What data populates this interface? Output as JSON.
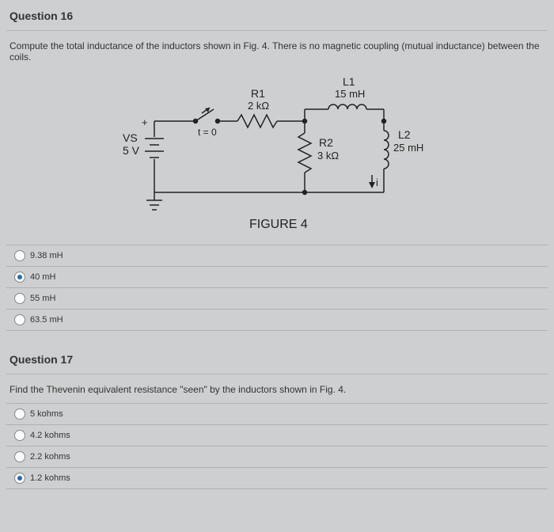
{
  "q16": {
    "header": "Question 16",
    "prompt": "Compute the total inductance of the inductors shown in Fig. 4. There is no magnetic coupling (mutual inductance) between the coils.",
    "figure_caption": "FIGURE 4",
    "labels": {
      "R1_name": "R1",
      "R1_val": "2 kΩ",
      "L1_name": "L1",
      "L1_val": "15 mH",
      "R2_name": "R2",
      "R2_val": "3 kΩ",
      "L2_name": "L2",
      "L2_val": "25 mH",
      "vs_name": "VS",
      "vs_val": "5 V",
      "t0": "t = 0",
      "plus": "+",
      "i": "i"
    },
    "options": [
      {
        "label": "9.38 mH",
        "selected": false
      },
      {
        "label": "40 mH",
        "selected": true
      },
      {
        "label": "55 mH",
        "selected": false
      },
      {
        "label": "63.5 mH",
        "selected": false
      }
    ]
  },
  "q17": {
    "header": "Question 17",
    "prompt": "Find the Thevenin equivalent resistance \"seen\" by the inductors shown in Fig. 4.",
    "options": [
      {
        "label": "5 kohms",
        "selected": false
      },
      {
        "label": "4.2 kohms",
        "selected": false
      },
      {
        "label": "2.2 kohms",
        "selected": false
      },
      {
        "label": "1.2 kohms",
        "selected": true
      }
    ]
  }
}
